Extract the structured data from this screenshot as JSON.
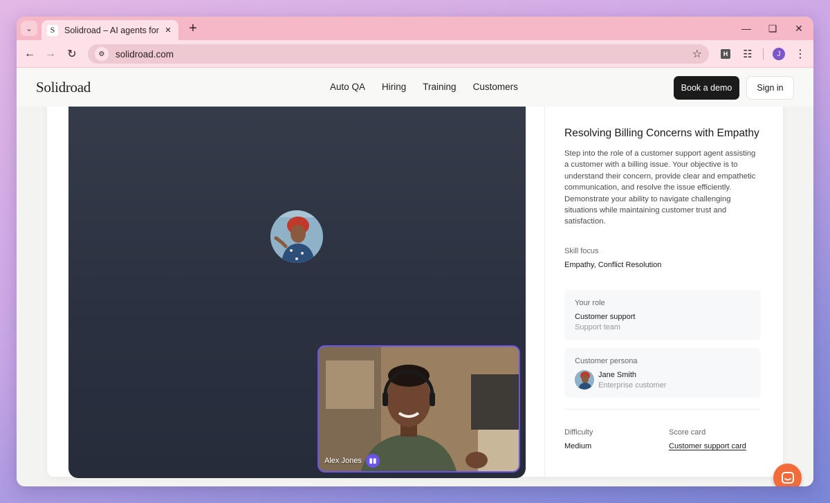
{
  "browser": {
    "tab_title": "Solidroad – AI agents for sales a",
    "favicon_letter": "S",
    "url": "solidroad.com",
    "profile_initial": "J",
    "extension_letter": "H"
  },
  "site": {
    "logo": "Solidroad",
    "nav": [
      "Auto QA",
      "Hiring",
      "Training",
      "Customers"
    ],
    "book_demo_label": "Book a demo",
    "sign_in_label": "Sign in"
  },
  "call": {
    "self_name": "Alex Jones",
    "accent_color": "#6b55e8"
  },
  "scenario": {
    "title": "Resolving Billing Concerns with Empathy",
    "description": "Step into the role of a customer support agent assisting a customer with a billing issue. Your objective is to understand their concern, provide clear and empathetic communication, and resolve the issue efficiently. Demonstrate your ability to navigate challenging situations while maintaining customer trust and satisfaction.",
    "skill_focus_label": "Skill focus",
    "skill_focus_value": "Empathy, Conflict Resolution",
    "role_label": "Your role",
    "role_value": "Customer support",
    "role_sub": "Support team",
    "persona_label": "Customer persona",
    "persona_name": "Jane Smith",
    "persona_sub": "Enterprise customer",
    "difficulty_label": "Difficulty",
    "difficulty_value": "Medium",
    "scorecard_label": "Score card",
    "scorecard_value": "Customer support card"
  },
  "colors": {
    "chat_launcher": "#f26b3a",
    "tabstrip": "#f6b7c6"
  }
}
